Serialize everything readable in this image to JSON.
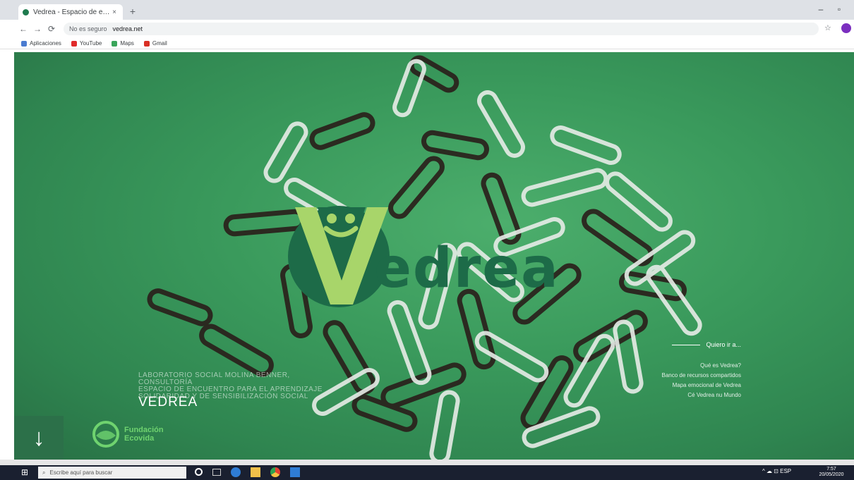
{
  "browser": {
    "tab_title": "Vedrea - Espacio de encuentro...",
    "tab_close": "×",
    "new_tab": "+",
    "back": "←",
    "forward": "→",
    "reload": "⟳",
    "secure_label": "No es seguro",
    "url": "vedrea.net",
    "bookmarks": [
      {
        "label": "Aplicaciones",
        "color": "#4a7bd0"
      },
      {
        "label": "YouTube",
        "color": "#e02a2a"
      },
      {
        "label": "Maps",
        "color": "#3aa55a"
      },
      {
        "label": "Gmail",
        "color": "#d93025"
      }
    ],
    "min": "–",
    "max": "▫"
  },
  "hero": {
    "logo_word": "edrea",
    "tagline_lines": [
      "LABORATORIO SOCIAL MOLINA BENNER, CONSULTORÍA",
      "ESPACIO DE ENCUENTRO PARA EL APRENDIZAJE",
      "SOLIDARIDAD Y DE SENSIBILIZACIÓN SOCIAL"
    ],
    "brand_name": "VEDREA",
    "scroll_arrow": "↓",
    "partner_text_line1": "Fundación",
    "partner_text_line2": "Ecovida",
    "colors": {
      "background": "#3a9a5c",
      "logo_dark": "#1d6b48",
      "logo_light": "#a8d56a"
    }
  },
  "menu": {
    "title": "Quiero ir a...",
    "items": [
      "Qué es Vedrea?",
      "Banco de recursos compartidos",
      "Mapa emocional de Vedrea",
      "Cé Vedrea nu Mundo"
    ]
  },
  "taskbar": {
    "start_icon": "⊞",
    "search_placeholder": "Escribe aquí para buscar",
    "tray_text": "^ ☁ ⊡ ESP",
    "time": "7:57",
    "date": "20/05/2020"
  }
}
